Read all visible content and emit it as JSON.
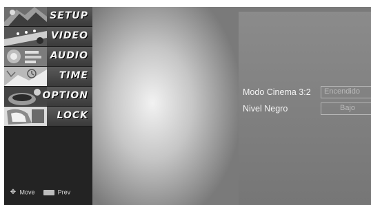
{
  "menu": {
    "items": [
      {
        "label": "SETUP",
        "icon": "setup-thumbnail-icon"
      },
      {
        "label": "VIDEO",
        "icon": "video-thumbnail-icon"
      },
      {
        "label": "AUDIO",
        "icon": "audio-thumbnail-icon"
      },
      {
        "label": "TIME",
        "icon": "time-thumbnail-icon"
      },
      {
        "label": "OPTION",
        "icon": "option-thumbnail-icon"
      },
      {
        "label": "LOCK",
        "icon": "lock-thumbnail-icon"
      }
    ]
  },
  "hints": {
    "move_label": "Move",
    "prev_label": "Prev",
    "move_icon": "four-way-arrow-icon",
    "prev_icon": "menu-key-icon"
  },
  "settings": {
    "rows": [
      {
        "label": "Modo Cinema 3:2",
        "value": "Encendido"
      },
      {
        "label": "Nivel Negro",
        "value": "Bajo"
      }
    ]
  }
}
